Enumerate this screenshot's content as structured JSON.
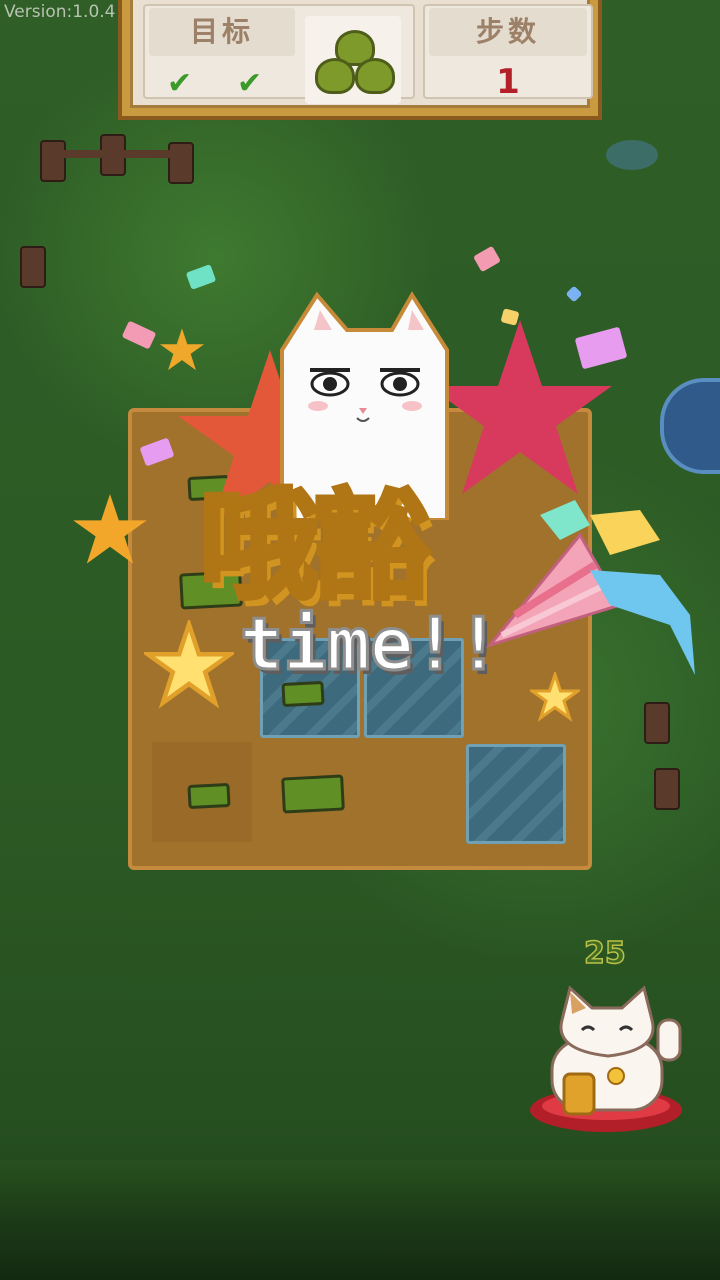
{
  "version_label": "Version:1.0.4",
  "hud": {
    "goal_label": "目标",
    "steps_label": "步数",
    "steps_value": "1",
    "goal_checks": [
      "✔",
      "✔"
    ]
  },
  "celebration": {
    "title_cn": "哦豁",
    "title_en": "time!!"
  },
  "timer_value": "25",
  "colors": {
    "hud_frame": "#c99a3f",
    "steps_value": "#b3202a",
    "title_fill": "#f7c83b",
    "grass": "#2f5e27"
  },
  "icons": [
    "checkmark-icon",
    "grass-tiles-icon",
    "star-icon",
    "party-popper-icon",
    "lucky-cat-icon"
  ]
}
